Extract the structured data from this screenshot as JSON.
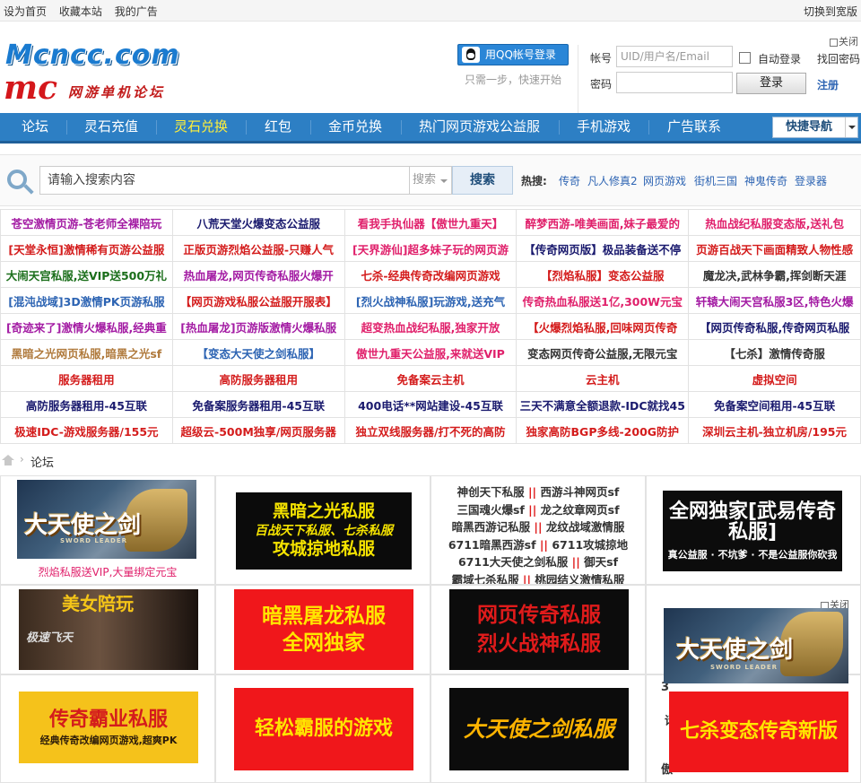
{
  "topbar": {
    "left_links": [
      "设为首页",
      "收藏本站",
      "我的广告"
    ],
    "right_link": "切换到宽版"
  },
  "header": {
    "logo_text": "Mcncc.com",
    "logo_mc": "mc",
    "logo_subtitle": "网游单机论坛",
    "qq_login": "用QQ帐号登录",
    "qq_note": "只需一步，快速开始",
    "username_label": "帐号",
    "username_placeholder": "UID/用户名/Email",
    "password_label": "密码",
    "remember": "自动登录",
    "forgot": "找回密码",
    "login_button": "登录",
    "register": "注册",
    "close": "关闭"
  },
  "nav": {
    "items": [
      "论坛",
      "灵石充值",
      "灵石兑换",
      "红包",
      "金币兑换",
      "热门网页游戏公益服",
      "手机游戏",
      "广告联系"
    ],
    "active_index": 2,
    "quick_nav": "快捷导航"
  },
  "search": {
    "placeholder": "请输入搜索内容",
    "type": "搜索",
    "button": "搜索",
    "hot_label": "热搜:",
    "hot_terms": [
      "传奇",
      "凡人修真2",
      "网页游戏",
      "街机三国",
      "神鬼传奇",
      "登录器"
    ]
  },
  "text_ads": [
    [
      {
        "t": "苍空激情页游-苍老师全裸陪玩",
        "c": "#a31ba3"
      },
      {
        "t": "八荒天堂火爆变态公益服",
        "c": "#1a1a6e"
      },
      {
        "t": "看我手执仙器【傲世九重天】",
        "c": "#e0206b"
      },
      {
        "t": "醉梦西游-唯美画面,妹子最爱的",
        "c": "#e0206b"
      },
      {
        "t": "热血战纪私服变态版,送礼包",
        "c": "#e0206b"
      }
    ],
    [
      {
        "t": "[天堂永恒]激情稀有页游公益服",
        "c": "#d41c1c"
      },
      {
        "t": "正版页游烈焰公益服-只赚人气",
        "c": "#d41c1c"
      },
      {
        "t": "[天界游仙]超多妹子玩的网页游",
        "c": "#e0206b"
      },
      {
        "t": "【传奇网页版】极品装备送不停",
        "c": "#1a1a6e"
      },
      {
        "t": "页游百战天下画面精致人物性感",
        "c": "#d41c1c"
      }
    ],
    [
      {
        "t": "大闹天宫私服,送VIP送500万礼",
        "c": "#1a6e1a"
      },
      {
        "t": "热血屠龙,网页传奇私服火爆开",
        "c": "#a31ba3"
      },
      {
        "t": "七杀-经典传奇改编网页游戏",
        "c": "#d41c1c"
      },
      {
        "t": "【烈焰私服】变态公益服",
        "c": "#d41c1c"
      },
      {
        "t": "魔龙决,武林争霸,挥剑断天涯",
        "c": "#333333"
      }
    ],
    [
      {
        "t": "[混沌战域]3D激情PK页游私服",
        "c": "#2d64b3"
      },
      {
        "t": "【网页游戏私服公益服开服表】",
        "c": "#d41c1c"
      },
      {
        "t": "[烈火战神私服]玩游戏,送充气",
        "c": "#2d64b3"
      },
      {
        "t": "传奇热血私服送1亿,300W元宝",
        "c": "#e0206b"
      },
      {
        "t": "轩辕大闹天宫私服3区,特色火爆",
        "c": "#a31ba3"
      }
    ],
    [
      {
        "t": "[奇迹来了]激情火爆私服,经典重",
        "c": "#a31ba3"
      },
      {
        "t": "[热血屠龙]页游版激情火爆私服",
        "c": "#a31ba3"
      },
      {
        "t": "超变热血战纪私服,独家开放",
        "c": "#e0206b"
      },
      {
        "t": "【火爆烈焰私服,回味网页传奇",
        "c": "#d41c1c"
      },
      {
        "t": "【网页传奇私服,传奇网页私服",
        "c": "#1a1a6e"
      }
    ],
    [
      {
        "t": "黑暗之光网页私服,暗黑之光sf",
        "c": "#b07a3c"
      },
      {
        "t": "【变态大天使之剑私服】",
        "c": "#2d64b3"
      },
      {
        "t": "傲世九重天公益服,来就送VIP",
        "c": "#e0206b"
      },
      {
        "t": "变态网页传奇公益服,无限元宝",
        "c": "#333333"
      },
      {
        "t": "【七杀】激情传奇服",
        "c": "#333333"
      }
    ],
    [
      {
        "t": "服务器租用",
        "c": "#d41c1c"
      },
      {
        "t": "高防服务器租用",
        "c": "#d41c1c"
      },
      {
        "t": "免备案云主机",
        "c": "#d41c1c"
      },
      {
        "t": "云主机",
        "c": "#d41c1c"
      },
      {
        "t": "虚拟空间",
        "c": "#d41c1c"
      }
    ],
    [
      {
        "t": "高防服务器租用-45互联",
        "c": "#1a1a6e"
      },
      {
        "t": "免备案服务器租用-45互联",
        "c": "#1a1a6e"
      },
      {
        "t": "400电话**网站建设-45互联",
        "c": "#1a1a6e"
      },
      {
        "t": "三天不满意全额退款-IDC就找45",
        "c": "#1a1a6e"
      },
      {
        "t": "免备案空间租用-45互联",
        "c": "#1a1a6e"
      }
    ],
    [
      {
        "t": "极速IDC-游戏服务器/155元",
        "c": "#d41c1c"
      },
      {
        "t": "超级云-500M独享/网页服务器",
        "c": "#d41c1c"
      },
      {
        "t": "独立双线服务器/打不死的高防",
        "c": "#d41c1c"
      },
      {
        "t": "独家高防BGP多线-200G防护",
        "c": "#d41c1c"
      },
      {
        "t": "深圳云主机-独立机房/195元",
        "c": "#d41c1c"
      }
    ]
  ],
  "breadcrumb": "论坛",
  "banners": {
    "r1c1_title": "大天使之剑",
    "r1c1_sub": "SWORD LEADER",
    "r1c1_caption": "烈焰私服送VIP,大量绑定元宝",
    "r1c2_lines": [
      "黑暗之光私服",
      "百战天下私服、七杀私服",
      "攻城掠地私服"
    ],
    "r1c3_lines": [
      [
        "神创天下私服",
        "西游斗神网页sf"
      ],
      [
        "三国魂火爆sf",
        "龙之纹章网页sf"
      ],
      [
        "暗黑西游记私服",
        "龙纹战域激情服"
      ],
      [
        "6711暗黑西游sf",
        "6711攻城掠地"
      ],
      [
        "6711大天使之剑私服",
        "御天sf"
      ],
      [
        "霸域七杀私服",
        "桃园结义激情私服"
      ]
    ],
    "r1c4_lines": [
      "全网独家[武易传奇私服]",
      "真公益服 · 不坑爹 · 不是公益服你砍我"
    ],
    "r2c1_lines": [
      "美女陪玩",
      "极速飞天"
    ],
    "r2c2_lines": [
      "暗黑屠龙私服",
      "全网独家"
    ],
    "r2c3_lines": [
      "网页传奇私服",
      "烈火战神私服"
    ],
    "r3c1_lines": [
      "传奇霸业私服",
      "经典传奇改编网页游戏,超爽PK"
    ],
    "r3c2_text": "轻松霸服的游戏",
    "r3c3_text": "大天使之剑私服",
    "float_close": "关闭",
    "float_ad1_title": "大天使之剑",
    "float_ad1_sub": "SWORD LEADER",
    "float_ad2_text": "七杀变态传奇新版",
    "peek_chars": [
      "3",
      "话",
      "傲"
    ]
  }
}
